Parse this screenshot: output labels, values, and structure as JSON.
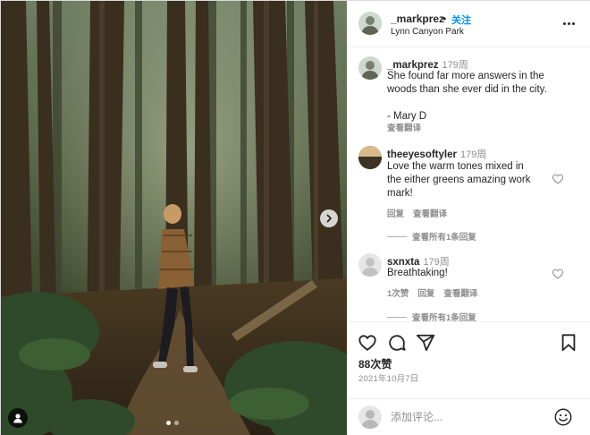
{
  "post": {
    "author": "_markprez",
    "separator": "•",
    "follow_label": "关注",
    "location": "Lynn Canyon Park",
    "more_icon": "more-horizontal-icon",
    "photo_icons": {
      "next": "chevron-right-icon",
      "tagged_users": "user-icon"
    }
  },
  "caption": {
    "username": "_markprez",
    "time": "179周",
    "text_line1": "She found far more answers in the",
    "text_line2": "woods than she ever did in the city.",
    "text_line3": "- Mary D",
    "translate_label": "查看翻译"
  },
  "comments": [
    {
      "username": "theeyesoftyler",
      "time": "179周",
      "text_line1": "Love the warm tones mixed in",
      "text_line2": "the either greens amazing work",
      "text_line3": "mark!",
      "reply_label": "回复",
      "translate_label": "查看翻译",
      "view_replies_label": "查看所有1条回复"
    },
    {
      "username": "sxnxta",
      "time": "179周",
      "text_line1": "Breathtaking!",
      "likes_label": "1次赞",
      "reply_label": "回复",
      "translate_label": "查看翻译",
      "view_replies_label": "查看所有1条回复"
    }
  ],
  "actions": {
    "icons": [
      "heart-icon",
      "comment-icon",
      "share-icon",
      "bookmark-icon"
    ],
    "likes_label": "88次赞",
    "date_label": "2021年10月7日"
  },
  "add_comment": {
    "placeholder": "添加评论...",
    "emoji_icon": "emoji-icon"
  },
  "carousel": {
    "slides": 2,
    "active_slide": 1
  },
  "colors": {
    "accent": "#0095f6",
    "text": "#262626",
    "muted": "#8e8e8e",
    "border": "#dbdbdb"
  }
}
